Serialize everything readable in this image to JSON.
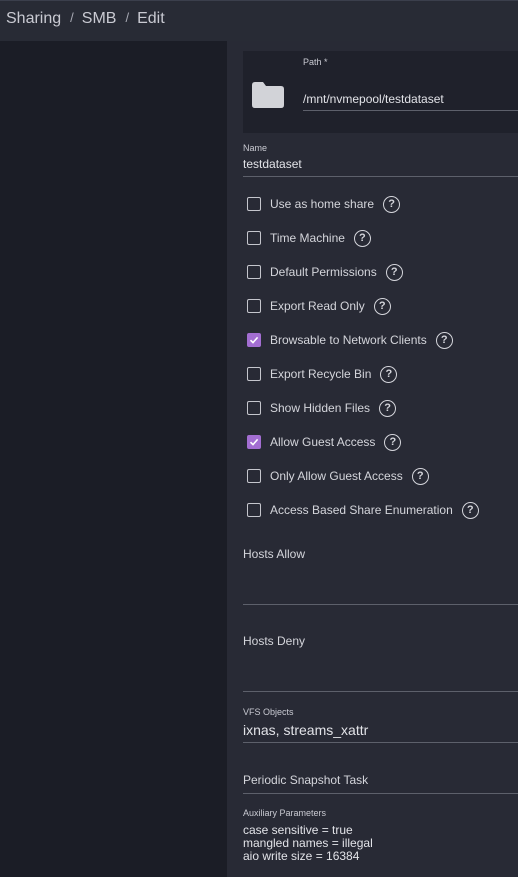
{
  "breadcrumb": {
    "items": [
      "Sharing",
      "SMB",
      "Edit"
    ],
    "separator": "/"
  },
  "path": {
    "label": "Path *",
    "value": "/mnt/nvmepool/testdataset",
    "icon": "folder-icon"
  },
  "name": {
    "label": "Name",
    "value": "testdataset"
  },
  "options": [
    {
      "label": "Use as home share",
      "checked": false
    },
    {
      "label": "Time Machine",
      "checked": false
    },
    {
      "label": "Default Permissions",
      "checked": false
    },
    {
      "label": "Export Read Only",
      "checked": false
    },
    {
      "label": "Browsable to Network Clients",
      "checked": true
    },
    {
      "label": "Export Recycle Bin",
      "checked": false
    },
    {
      "label": "Show Hidden Files",
      "checked": false
    },
    {
      "label": "Allow Guest Access",
      "checked": true
    },
    {
      "label": "Only Allow Guest Access",
      "checked": false
    },
    {
      "label": "Access Based Share Enumeration",
      "checked": false
    }
  ],
  "help_glyph": "?",
  "hosts_allow": {
    "label": "Hosts Allow",
    "value": ""
  },
  "hosts_deny": {
    "label": "Hosts Deny",
    "value": ""
  },
  "vfs_objects": {
    "label": "VFS Objects",
    "value": "ixnas, streams_xattr"
  },
  "periodic_snapshot": {
    "label": "Periodic Snapshot Task"
  },
  "auxiliary": {
    "label": "Auxiliary Parameters",
    "lines": [
      "case sensitive = true",
      "mangled names = illegal",
      "aio write size = 16384"
    ]
  },
  "colors": {
    "accent": "#a36ed2",
    "background": "#1e2029",
    "panel": "#282a35"
  }
}
